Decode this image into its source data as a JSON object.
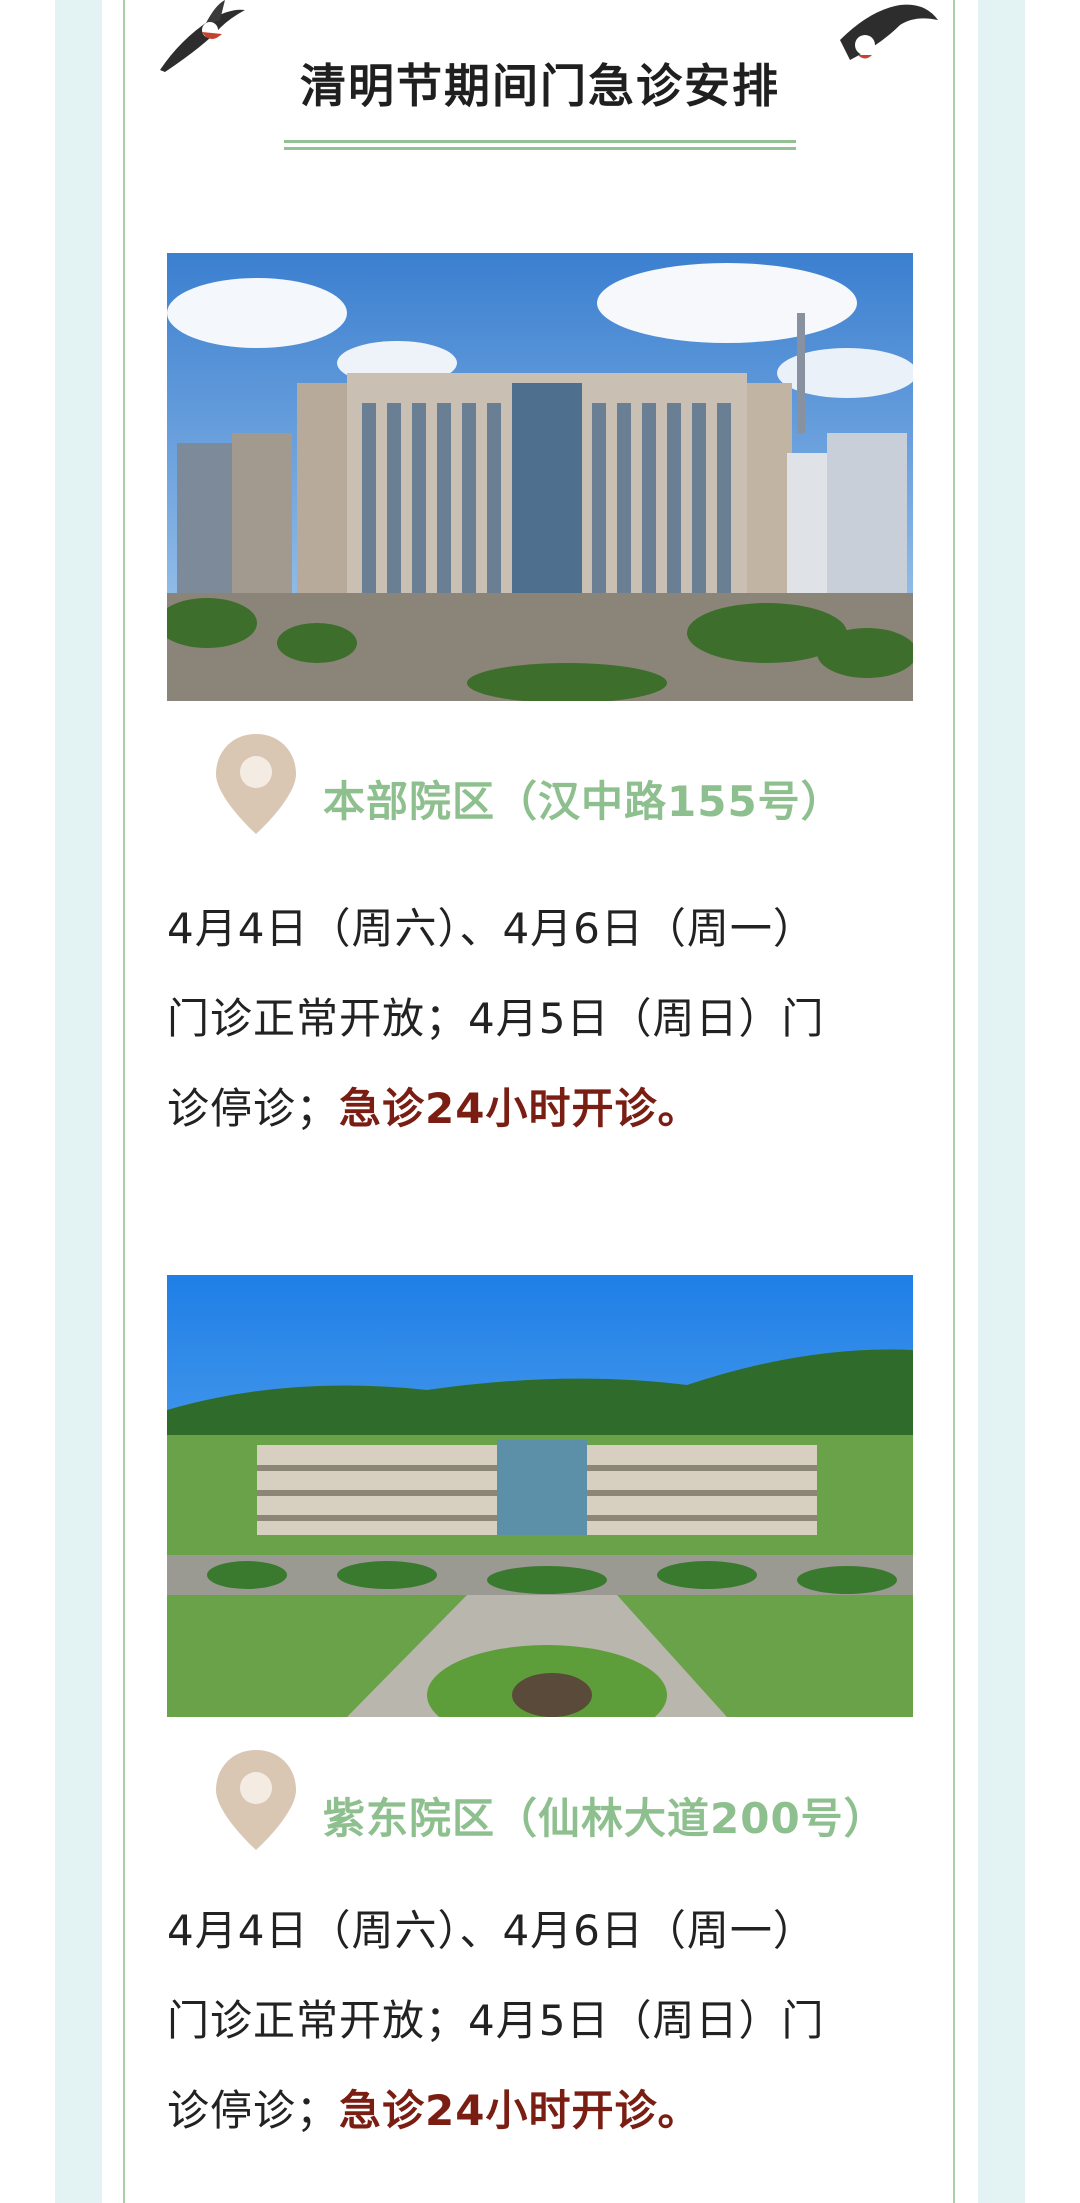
{
  "header": {
    "title": "清明节期间门急诊安排"
  },
  "campuses": [
    {
      "name": "本部院区（汉中路155号）",
      "schedule_line1": "4月4日（周六）、4月6日（周一）",
      "schedule_line2": "门诊正常开放；4月5日（周日）门",
      "schedule_line3_prefix": "诊停诊；",
      "schedule_line3_highlight": "急诊24小时开诊。"
    },
    {
      "name": "紫东院区（仙林大道200号）",
      "schedule_line1": "4月4日（周六）、4月6日（周一）",
      "schedule_line2": "门诊正常开放；4月5日（周日）门",
      "schedule_line3_prefix": "诊停诊；",
      "schedule_line3_highlight": "急诊24小时开诊。"
    }
  ],
  "colors": {
    "frame": "#e3f3f4",
    "accent_green": "#8ebf8e",
    "highlight": "#7a1d12",
    "pin": "#d9c7b4"
  },
  "icons": [
    "swallow-bird-icon",
    "location-pin-icon"
  ]
}
